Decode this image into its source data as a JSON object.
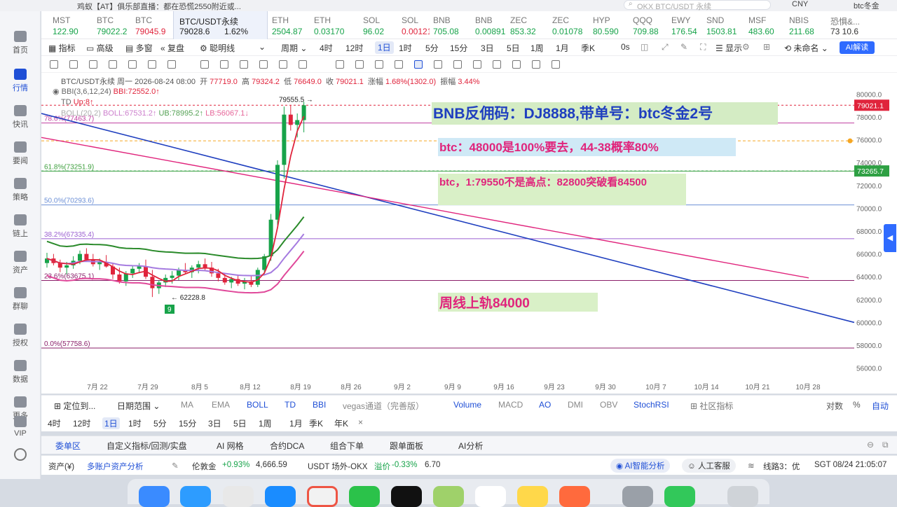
{
  "top_strip": {
    "text": "鸡蚁【AT】俱乐部直播：都在恐慌2550附近或..."
  },
  "sidebar": {
    "items": [
      {
        "label": "首页"
      },
      {
        "label": "行情"
      },
      {
        "label": "快讯"
      },
      {
        "label": "要闻"
      },
      {
        "label": "策略"
      },
      {
        "label": "链上"
      },
      {
        "label": "资产"
      },
      {
        "label": "群聊"
      },
      {
        "label": "授权"
      },
      {
        "label": "数据"
      },
      {
        "label": "更多"
      },
      {
        "label": "VIP"
      }
    ]
  },
  "header": {
    "search_placeholder": "OKX BTC/USDT 永续",
    "currency": "CNY",
    "user": "btc冬金"
  },
  "tickers": [
    {
      "name": "MST",
      "price": "122.90",
      "dir": "up"
    },
    {
      "name": "BTC",
      "price": "79022.2",
      "dir": "up"
    },
    {
      "name": "BTC",
      "price": "79045.9",
      "dir": "dn"
    },
    {
      "name": "BTC/USDT永续",
      "price": "79028.6",
      "chg": "1.62%",
      "dir": "up"
    },
    {
      "name": "ETH",
      "price": "2504.87",
      "dir": "up"
    },
    {
      "name": "ETH",
      "price": "0.03170",
      "dir": "up"
    },
    {
      "name": "SOL",
      "price": "96.02",
      "dir": "up"
    },
    {
      "name": "SOL",
      "price": "0.00121",
      "dir": "dn"
    },
    {
      "name": "BNB",
      "price": "705.08",
      "dir": "up"
    },
    {
      "name": "BNB",
      "price": "0.00891",
      "dir": "up"
    },
    {
      "name": "ZEC",
      "price": "853.32",
      "dir": "up"
    },
    {
      "name": "ZEC",
      "price": "0.01078",
      "dir": "up"
    },
    {
      "name": "HYP",
      "price": "80.590",
      "dir": "up"
    },
    {
      "name": "QQQ",
      "price": "709.88",
      "dir": "up"
    },
    {
      "name": "EWY",
      "price": "176.54",
      "dir": "up"
    },
    {
      "name": "SND",
      "price": "1503.81",
      "dir": "up"
    },
    {
      "name": "MSF",
      "price": "483.60",
      "dir": "up"
    },
    {
      "name": "NBIS",
      "price": "211.68",
      "dir": "up"
    },
    {
      "name": "恐惧&...",
      "price": "73 10.6",
      "dir": "neutral"
    }
  ],
  "toolbar": {
    "indicators": "指标",
    "advanced": "高级",
    "multi": "多窗",
    "replay": "复盘",
    "smart": "聪明线",
    "period": "周期",
    "intervals": [
      "4时",
      "12时",
      "1日",
      "1时",
      "5分",
      "15分",
      "3日",
      "5日",
      "1周",
      "1月",
      "季K"
    ],
    "selected_interval": "1日",
    "countdown": "0s",
    "display": "显示",
    "unnamed": "未命名",
    "ai": "AI解读"
  },
  "chart_header": {
    "symbol_line": "BTC/USDT永续  周一 2026-08-24 08:00",
    "open_label": "开",
    "open": "77719.0",
    "high_label": "高",
    "high": "79324.2",
    "low_label": "低",
    "low": "76649.0",
    "close_label": "收",
    "close": "79021.1",
    "change_label": "涨幅",
    "change": "1.68%(1302.0)",
    "amp_label": "振幅",
    "amp": "3.44%",
    "bbi": "BBI(3,6,12,24)",
    "bbi_val": "BBI:72552.0↑",
    "td": "TD",
    "td_val": "Up:8↑",
    "boll": "BOLL(20,2)",
    "boll_val": "BOLL:67531.2↑",
    "ub": "UB:78995.2↑",
    "lb": "LB:56067.1↓"
  },
  "chart_data": {
    "type": "candlestick",
    "title": "BTC/USDT永续",
    "x_ticks": [
      "7月 22",
      "7月 29",
      "8月 5",
      "8月 12",
      "8月 19",
      "8月 26",
      "9月 2",
      "9月 9",
      "9月 16",
      "9月 23",
      "9月 30",
      "10月 7",
      "10月 14",
      "10月 21",
      "10月 28"
    ],
    "y_ticks": [
      "80000.0",
      "78000.0",
      "76000.0",
      "74000.0",
      "72000.0",
      "70000.0",
      "68000.0",
      "66000.0",
      "64000.0",
      "62000.0",
      "60000.0",
      "58000.0",
      "56000.0"
    ],
    "y_range": [
      55000,
      81000
    ],
    "fib_levels": [
      {
        "label": "78.6%(77463.7)",
        "value": 77463.7,
        "color": "#c03fa0"
      },
      {
        "label": "61.8%(73251.9)",
        "value": 73251.9,
        "color": "#3fa03f"
      },
      {
        "label": "50.0%(70293.6)",
        "value": 70293.6,
        "color": "#6b8fd6"
      },
      {
        "label": "38.2%(67335.4)",
        "value": 67335.4,
        "color": "#9a5fd0"
      },
      {
        "label": "23.6%(63675.1)",
        "value": 63675.1,
        "color": "#8a1f6a"
      },
      {
        "label": "0.0%(57758.6)",
        "value": 57758.6,
        "color": "#8a1f6a"
      }
    ],
    "high_marker": "79555.5 →",
    "low_marker": "← 62228.8",
    "td_count_label": "9",
    "price_tags": [
      {
        "label": "79021.1",
        "value": 79021.1,
        "color": "#e0243c"
      },
      {
        "label": "73265.7",
        "value": 73265.7,
        "color": "#2ea043"
      }
    ],
    "candles": [
      [
        65200,
        66100,
        64800,
        65600
      ],
      [
        65600,
        66000,
        65000,
        65200
      ],
      [
        65200,
        65500,
        64400,
        64800
      ],
      [
        64800,
        65300,
        64200,
        65000
      ],
      [
        65000,
        65800,
        64700,
        65400
      ],
      [
        65400,
        66300,
        65100,
        66000
      ],
      [
        66000,
        66500,
        65300,
        65500
      ],
      [
        65500,
        66000,
        64900,
        65100
      ],
      [
        65100,
        65600,
        64600,
        65300
      ],
      [
        65300,
        65900,
        64800,
        64900
      ],
      [
        64900,
        65200,
        63800,
        64200
      ],
      [
        64200,
        64800,
        63400,
        63600
      ],
      [
        63600,
        64500,
        63200,
        64300
      ],
      [
        64300,
        65000,
        63900,
        64700
      ],
      [
        64700,
        65200,
        64300,
        64900
      ],
      [
        64900,
        65500,
        63800,
        64000
      ],
      [
        64000,
        64600,
        62228,
        63000
      ],
      [
        63000,
        63700,
        62500,
        63500
      ],
      [
        63500,
        64200,
        63100,
        63900
      ],
      [
        63900,
        64500,
        63400,
        64100
      ],
      [
        64100,
        64800,
        63700,
        64600
      ],
      [
        64600,
        65200,
        64200,
        64400
      ],
      [
        64400,
        65000,
        63900,
        64800
      ],
      [
        64800,
        65400,
        64300,
        65100
      ],
      [
        65100,
        65600,
        64600,
        64800
      ],
      [
        64800,
        65300,
        64000,
        64300
      ],
      [
        64300,
        64700,
        63600,
        63900
      ],
      [
        63900,
        64300,
        63300,
        63500
      ],
      [
        63500,
        64000,
        63000,
        63800
      ],
      [
        63800,
        64200,
        63200,
        63400
      ],
      [
        63400,
        63900,
        62900,
        63600
      ],
      [
        63600,
        64100,
        63100,
        63300
      ],
      [
        63300,
        64800,
        63100,
        64600
      ],
      [
        64600,
        66000,
        64200,
        65800
      ],
      [
        65800,
        69500,
        65400,
        69000
      ],
      [
        69000,
        74200,
        68500,
        73800
      ],
      [
        73800,
        78900,
        72600,
        78200
      ],
      [
        78200,
        79000,
        76800,
        77300
      ],
      [
        77300,
        78300,
        76200,
        77719
      ],
      [
        77719,
        79324,
        76649,
        79021
      ]
    ],
    "annotations": [
      {
        "text": "BNB反佣码：DJ8888,带单号：btc冬金2号",
        "color": "#1f3fbf"
      },
      {
        "text": "btc：48000是100%要去，44-38概率80%",
        "color": "#e0247c"
      },
      {
        "text": "btc，1:79550不是高点：82800突破看84500",
        "color": "#e0247c"
      },
      {
        "text": "周线上轨84000",
        "color": "#e0247c"
      }
    ]
  },
  "indicator_bar": {
    "locate": "定位到...",
    "range": "日期范围",
    "items": [
      "MA",
      "EMA",
      "BOLL",
      "TD",
      "BBI",
      "vegas通道（完善版）"
    ],
    "sub_items": [
      "Volume",
      "MACD",
      "AO",
      "DMI",
      "OBV",
      "StochRSI"
    ],
    "community": "社区指标",
    "log": "对数",
    "pct": "%",
    "auto": "自动"
  },
  "interval_row": [
    "4时",
    "12时",
    "1日",
    "1时",
    "5分",
    "15分",
    "3日",
    "5日",
    "1周",
    "1月",
    "季K",
    "年K"
  ],
  "bottom_tabs": [
    "委单区",
    "自定义指标/回测/实盘",
    "AI 网格",
    "合约DCA",
    "组合下单",
    "跟单面板",
    "AI分析"
  ],
  "status": {
    "assets": "资产(¥)",
    "multi": "多账户资产分析",
    "gold_label": "伦敦金",
    "gold_chg": "+0.93%",
    "gold_price": "4,666.59",
    "usdt_label": "USDT 场外-OKX",
    "premium_label": "溢价",
    "premium": "-0.33%",
    "usdt_price": "6.70",
    "ai": "AI智能分析",
    "service": "人工客服",
    "line": "线路3：优",
    "time": "SGT 08/24 21:05:07"
  },
  "colors": {
    "accent": "#1f4fd6",
    "up": "#17a34a",
    "down": "#e0243c"
  }
}
